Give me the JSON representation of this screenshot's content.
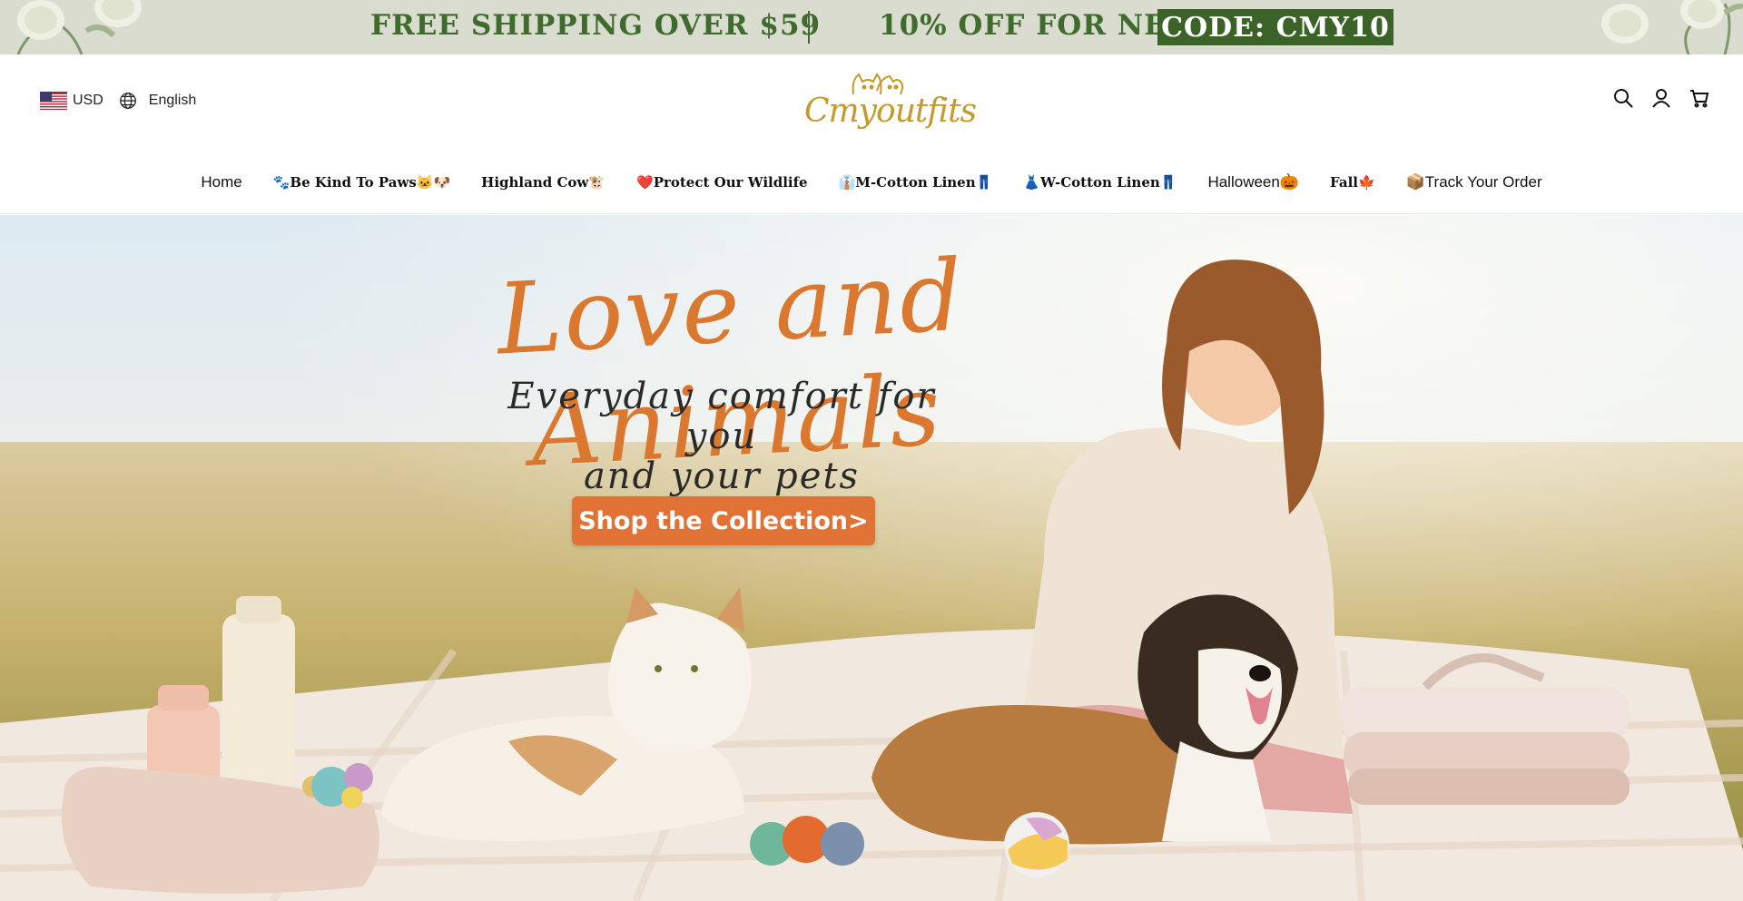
{
  "announcement": {
    "shipping": "FREE SHIPPING OVER $59",
    "discount": "10% OFF FOR NEW",
    "code": "CODE: CMY10",
    "colors": {
      "background": "#d9dccf",
      "text": "#3f6b2d",
      "code_bg": "#3b6227"
    }
  },
  "header": {
    "currency": "USD",
    "language": "English",
    "logo_text": "Cmyoutfits",
    "icons": [
      "search-icon",
      "account-icon",
      "cart-icon"
    ]
  },
  "nav": {
    "items": [
      {
        "label": "Home"
      },
      {
        "label": "🐾Be Kind To Paws🐱🐶"
      },
      {
        "label": "Highland Cow🐮"
      },
      {
        "label": "❤️Protect Our Wildlife"
      },
      {
        "label": "👔M-Cotton Linen👖"
      },
      {
        "label": "👗W-Cotton Linen👖"
      },
      {
        "label": "Halloween🎃"
      },
      {
        "label": "Fall🍁"
      },
      {
        "label": "📦Track Your Order"
      }
    ]
  },
  "hero": {
    "title": "Love and Animals",
    "subtitle_line1": "Everyday comfort for you",
    "subtitle_line2": "and your pets",
    "cta_label": "Shop the Collection>",
    "colors": {
      "title": "#d9782e",
      "cta": "#e07235"
    }
  }
}
